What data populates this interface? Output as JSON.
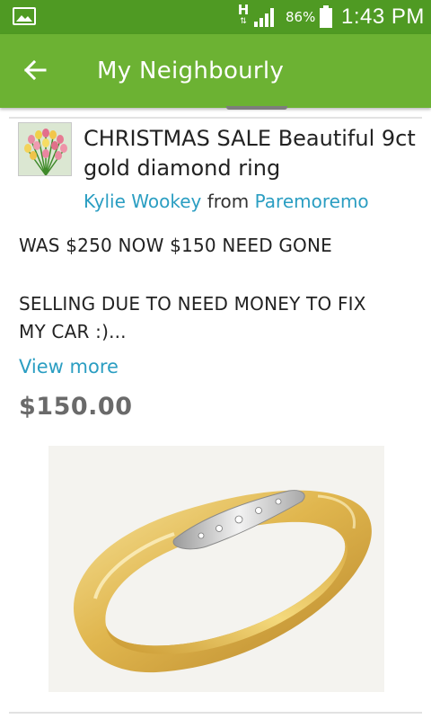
{
  "status_bar": {
    "network_type": "H",
    "battery_percent": "86%",
    "time": "1:43 PM",
    "icons": [
      "gallery-icon",
      "network-arrows-icon",
      "signal-icon",
      "battery-icon"
    ]
  },
  "app_bar": {
    "title": "My Neighbourly",
    "back_icon": "arrow-left-icon"
  },
  "post": {
    "title": "CHRISTMAS SALE  Beautiful 9ct gold diamond ring",
    "author": "Kylie Wookey",
    "from_word": "from",
    "location": "Paremoremo",
    "body_lines": [
      "WAS $250 NOW $150 NEED GONE",
      "SELLING DUE TO NEED MONEY TO FIX",
      "MY CAR :)..."
    ],
    "view_more_label": "View more",
    "price": "$150.00"
  },
  "colors": {
    "status_bar": "#4f9a23",
    "app_bar": "#6cb233",
    "link": "#2b9ec2",
    "price": "#6a6a6a"
  }
}
